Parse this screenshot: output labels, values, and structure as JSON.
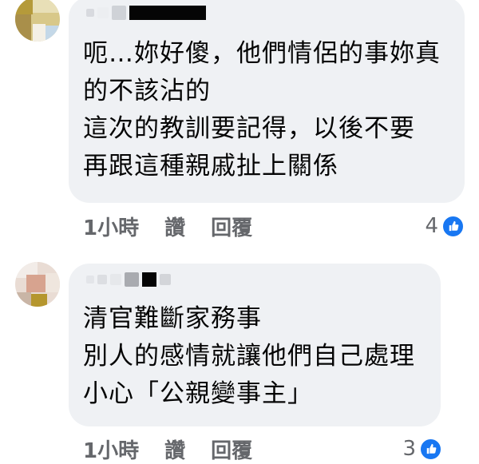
{
  "comments": [
    {
      "text_lines": [
        "呃…妳好傻，他們情侶的事妳真",
        "的不該沾的",
        "這次的教訓要記得，以後不要",
        "再跟這種親戚扯上關係"
      ],
      "time": "1小時",
      "like_label": "讚",
      "reply_label": "回覆",
      "reaction_count": "4"
    },
    {
      "text_lines": [
        "清官難斷家務事",
        "別人的感情就讓他們自己處理",
        "小心「公親變事主」"
      ],
      "time": "1小時",
      "like_label": "讚",
      "reply_label": "回覆",
      "reaction_count": "3"
    }
  ],
  "colors": {
    "bubble": "#eff1f4",
    "meta": "#65676b",
    "like_badge": "#1877f2"
  },
  "icons": {
    "reaction": "like-thumb-icon",
    "avatar": "profile-avatar"
  }
}
